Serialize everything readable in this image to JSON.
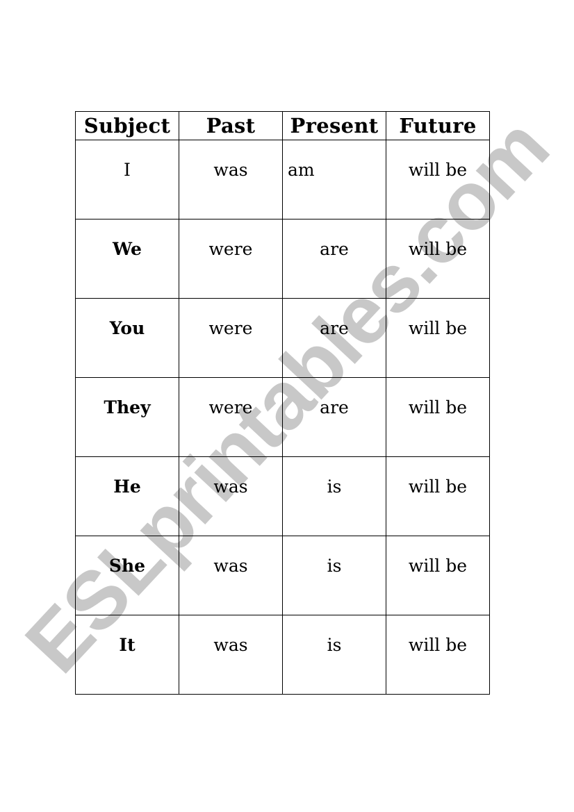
{
  "watermark": {
    "text": "ESLprintables.com",
    "color": "#c8c8c8"
  },
  "table": {
    "headers": [
      "Subject",
      "Past",
      "Present",
      "Future"
    ],
    "rows": [
      {
        "subject": "I",
        "past": "was",
        "present": "am",
        "future": "will be"
      },
      {
        "subject": "We",
        "past": "were",
        "present": "are",
        "future": "will be"
      },
      {
        "subject": "You",
        "past": "were",
        "present": "are",
        "future": "will be"
      },
      {
        "subject": "They",
        "past": "were",
        "present": "are",
        "future": "will be"
      },
      {
        "subject": "He",
        "past": "was",
        "present": "is",
        "future": "will be"
      },
      {
        "subject": "She",
        "past": "was",
        "present": "is",
        "future": "will be"
      },
      {
        "subject": "It",
        "past": "was",
        "present": "is",
        "future": "will be"
      }
    ]
  }
}
